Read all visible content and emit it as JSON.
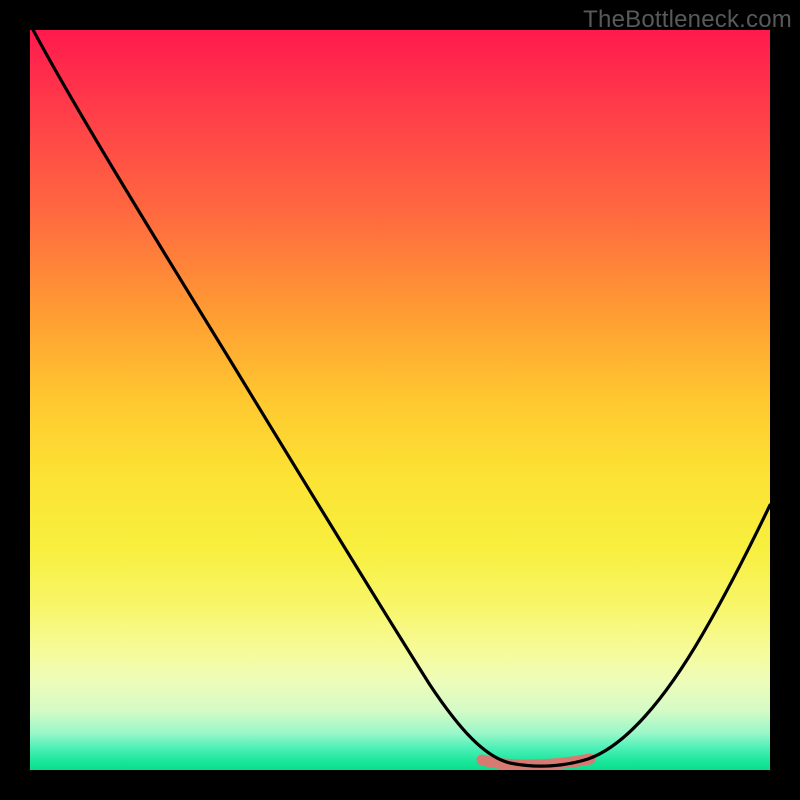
{
  "watermark": "TheBottleneck.com",
  "chart_data": {
    "type": "line",
    "title": "",
    "xlabel": "",
    "ylabel": "",
    "xlim": [
      0,
      100
    ],
    "ylim": [
      0,
      100
    ],
    "series": [
      {
        "name": "bottleneck-curve",
        "x": [
          0,
          6,
          12,
          18,
          24,
          30,
          36,
          42,
          48,
          54,
          58,
          62,
          66,
          70,
          74,
          78,
          82,
          86,
          90,
          94,
          100
        ],
        "y": [
          100,
          92,
          83,
          74,
          64,
          55,
          46,
          37,
          27,
          17,
          10,
          4,
          1,
          0,
          0,
          1,
          5,
          12,
          20,
          29,
          43
        ]
      },
      {
        "name": "flat-highlight",
        "x": [
          62,
          78
        ],
        "y": [
          0.8,
          0.8
        ]
      }
    ],
    "colors": {
      "curve": "#000000",
      "highlight": "#d97a72",
      "gradient_top": "#ff1a4d",
      "gradient_bottom": "#09df8e"
    }
  }
}
